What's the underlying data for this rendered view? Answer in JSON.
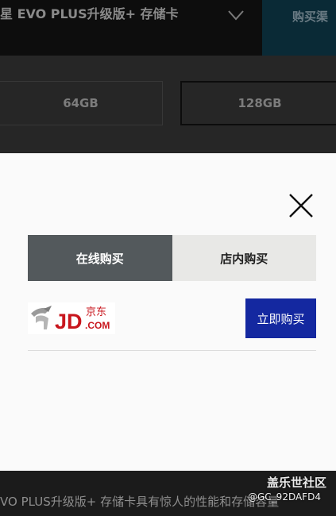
{
  "background": {
    "product_title": "星 EVO PLUS升级版+ 存储卡",
    "buy_now_label": "购买渠",
    "capacity_options": [
      "64GB",
      "128GB"
    ],
    "selected_capacity": "128GB",
    "description": "VO PLUS升级版+ 存储卡具有惊人的性能和存储容量"
  },
  "modal": {
    "tabs": [
      {
        "label": "在线购买",
        "active": true
      },
      {
        "label": "店内购买",
        "active": false
      }
    ],
    "seller": {
      "logo_text": "JD",
      "logo_cn": "京东",
      "logo_com": ".COM",
      "buy_label": "立即购买"
    }
  },
  "watermark": {
    "brand": "盖乐世社区",
    "user": "@GC_92DAFD4"
  },
  "colors": {
    "brand_blue": "#1428a0",
    "jd_red": "#c8161d",
    "tab_active": "#53595c",
    "tab_inactive": "#e8e8e6"
  }
}
